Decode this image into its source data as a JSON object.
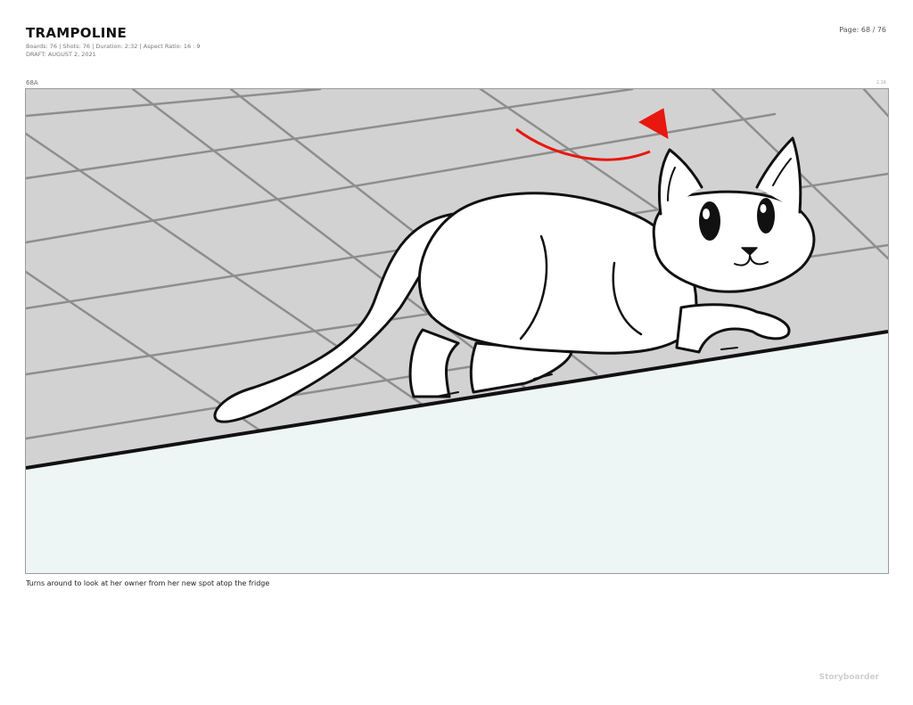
{
  "document": {
    "title": "TRAMPOLINE",
    "stats_line": "Boards: 76 | Shots: 76 | Duration: 2:32 | Aspect Ratio: 16 : 9",
    "draft_line": "DRAFT: AUGUST 2, 2021",
    "page_indicator": "Page: 68 / 76"
  },
  "board": {
    "number": "68A",
    "duration": "2.16",
    "caption": "Turns around to look at her owner from her new spot atop the fridge"
  },
  "illustration": {
    "subject": "cat",
    "colors": {
      "floor": "#d2d2d2",
      "floor_lines": "#8e8e8e",
      "fridge_top": "#eef6f5",
      "ink": "#111111",
      "arrow": "#e8170f"
    }
  },
  "branding": {
    "label": "Storyboarder"
  }
}
